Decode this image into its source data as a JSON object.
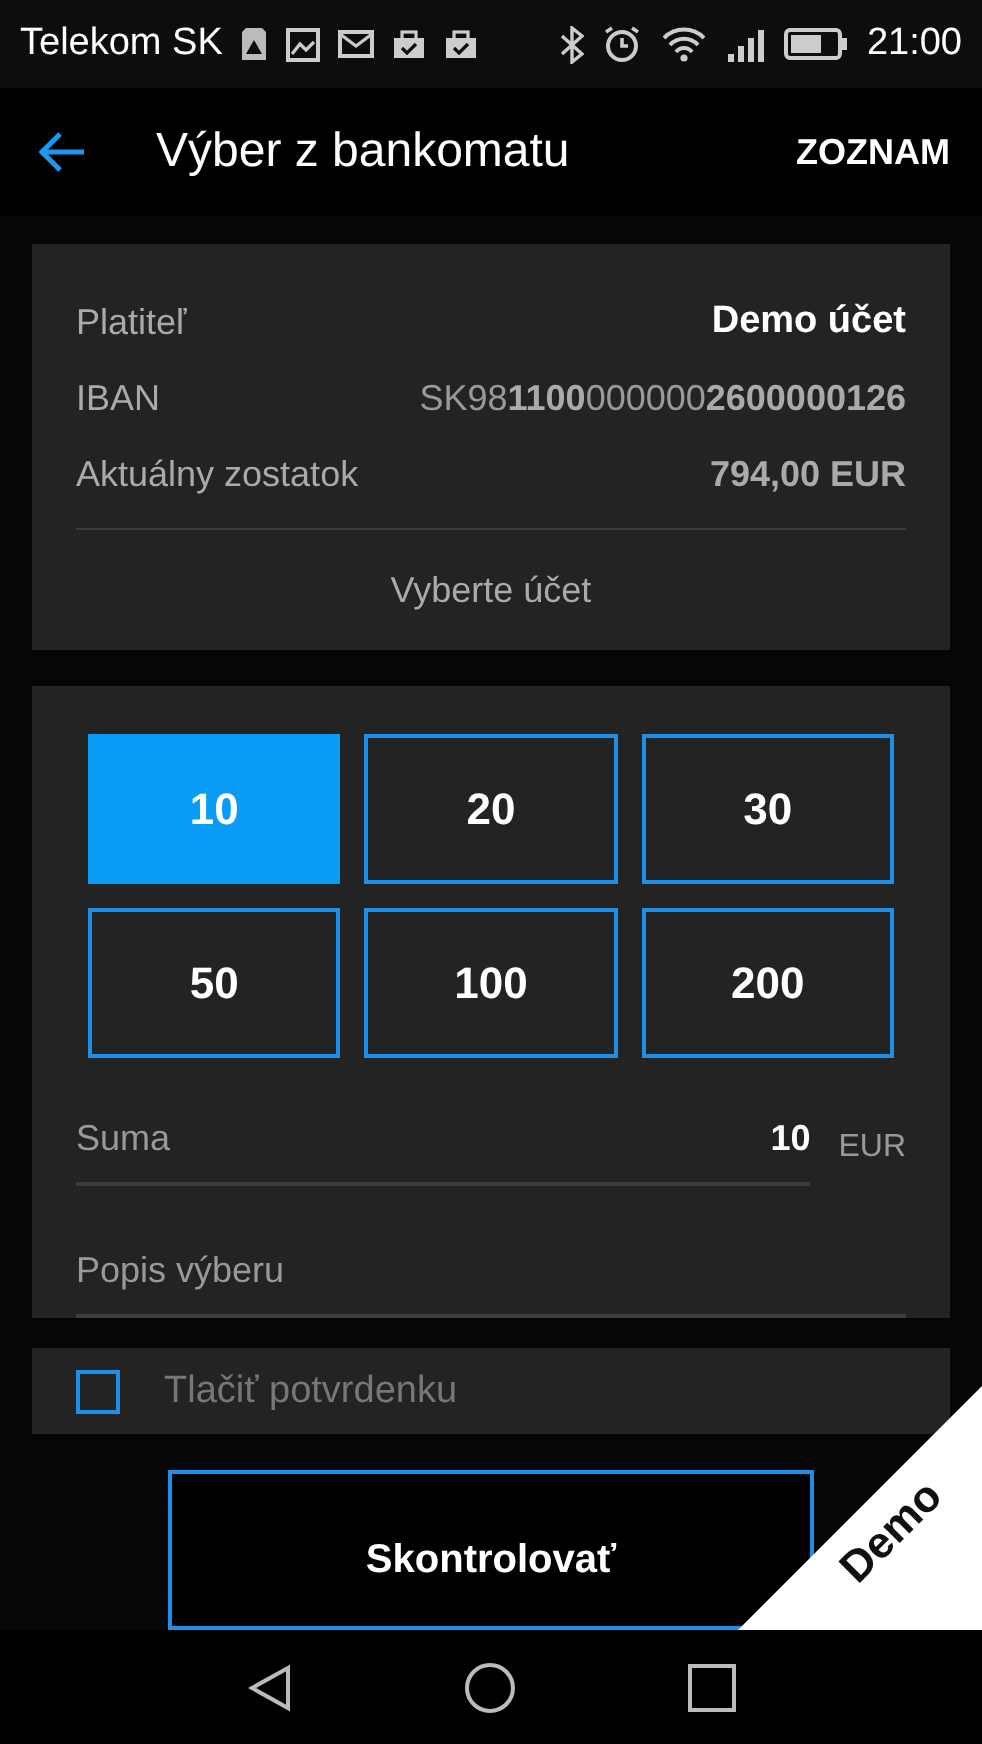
{
  "status_bar": {
    "carrier": "Telekom SK",
    "time": "21:00"
  },
  "header": {
    "title": "Výber z bankomatu",
    "action": "ZOZNAM"
  },
  "account": {
    "rows": [
      {
        "label": "Platiteľ",
        "value": "Demo účet",
        "kind": "name"
      },
      {
        "label": "IBAN",
        "value": "SK98**1100**000000**2600000126**",
        "kind": "iban"
      },
      {
        "label": "Aktuálny zostatok",
        "value": "794,00 EUR",
        "kind": "balance"
      }
    ],
    "select_button": "Vyberte účet"
  },
  "amounts": [
    {
      "label": "10",
      "selected": true
    },
    {
      "label": "20",
      "selected": false
    },
    {
      "label": "30",
      "selected": false
    },
    {
      "label": "50",
      "selected": false
    },
    {
      "label": "100",
      "selected": false
    },
    {
      "label": "200",
      "selected": false
    }
  ],
  "amount_field": {
    "label": "Suma",
    "value": "10",
    "currency": "EUR"
  },
  "description_field": {
    "placeholder": "Popis výberu"
  },
  "print_receipt": {
    "label": "Tlačiť potvrdenku",
    "checked": false
  },
  "submit_button": "Skontrolovať",
  "demo_ribbon": "Demo"
}
